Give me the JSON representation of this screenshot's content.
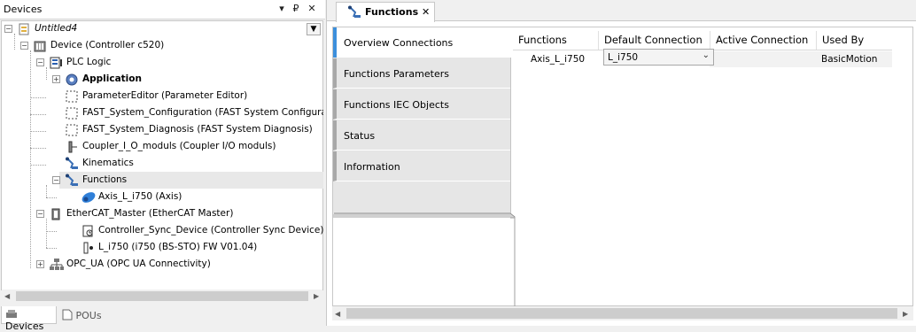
{
  "devices_panel": {
    "title": "Devices",
    "pin": "₽",
    "close": "✕"
  },
  "tree": [
    {
      "label": "Untitled4",
      "italic": true,
      "icon": "project-icon",
      "expander": "−"
    },
    {
      "label": "Device (Controller c520)",
      "icon": "controller-icon",
      "expander": "−"
    },
    {
      "label": "PLC Logic",
      "icon": "plc-logic-icon",
      "expander": "−"
    },
    {
      "label": "Application",
      "bold": true,
      "icon": "application-gear-icon",
      "expander": "+"
    },
    {
      "label": "ParameterEditor (Parameter Editor)",
      "icon": "dashed-box-icon"
    },
    {
      "label": "FAST_System_Configuration (FAST System Configuration)",
      "icon": "dashed-box-icon"
    },
    {
      "label": "FAST_System_Diagnosis (FAST System Diagnosis)",
      "icon": "dashed-box-icon"
    },
    {
      "label": "Coupler_I_O_moduls (Coupler I/O moduls)",
      "icon": "coupler-icon"
    },
    {
      "label": "Kinematics",
      "icon": "kinematics-icon"
    },
    {
      "label": "Functions",
      "icon": "functions-icon",
      "expander": "−",
      "selected": true
    },
    {
      "label": "Axis_L_i750 (Axis)",
      "icon": "axis-icon"
    },
    {
      "label": "EtherCAT_Master (EtherCAT Master)",
      "icon": "ethercat-icon",
      "expander": "−"
    },
    {
      "label": "Controller_Sync_Device (Controller Sync Device)",
      "icon": "sync-device-icon"
    },
    {
      "label": "L_i750 (i750 (BS-STO) FW V01.04)",
      "icon": "drive-icon"
    },
    {
      "label": "OPC_UA (OPC UA Connectivity)",
      "icon": "opcua-icon",
      "expander": "+"
    }
  ],
  "bottom_tabs": [
    {
      "label": "Devices",
      "active": true
    },
    {
      "label": "POUs",
      "active": false
    }
  ],
  "editor_tab": {
    "label": "Functions",
    "close": "✕"
  },
  "side_tabs": [
    {
      "label": "Overview Connections",
      "active": true
    },
    {
      "label": "Functions Parameters"
    },
    {
      "label": "Functions IEC Objects"
    },
    {
      "label": "Status"
    },
    {
      "label": "Information"
    }
  ],
  "table": {
    "headers": [
      "Functions",
      "Default Connection",
      "Active Connection",
      "Used By"
    ],
    "row": {
      "function": "Axis_L_i750",
      "default_connection": "L_i750",
      "active_connection": "",
      "used_by": "BasicMotion"
    }
  },
  "colors": {
    "accent": "#3c8fdc",
    "dropdown_bg": "#f4f4f4",
    "selection": "#e8e8e8"
  }
}
